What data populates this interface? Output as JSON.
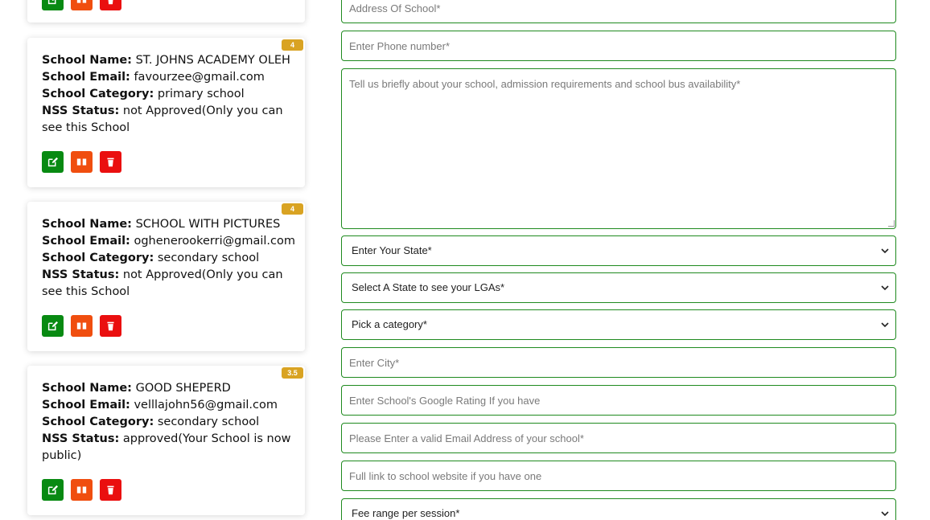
{
  "labels": {
    "name": "School Name:",
    "email": "School Email:",
    "category": "School Category:",
    "status": "NSS Status:"
  },
  "cards": [
    {
      "rating": "4",
      "name": "ST. JOHNS ACADEMY OLEH",
      "email": "favourzee@gmail.com",
      "category": "primary school",
      "status": "not Approved(Only you can see this School"
    },
    {
      "rating": "4",
      "name": "SCHOOL WITH PICTURES",
      "email": "oghenerookerri@gmail.com",
      "category": "secondary school",
      "status": "not Approved(Only you can see this School"
    },
    {
      "rating": "3.5",
      "name": "GOOD SHEPERD",
      "email": "velllajohn56@gmail.com",
      "category": "secondary school",
      "status": "approved(Your School is now public)"
    }
  ],
  "form": {
    "address_placeholder": "Address Of School*",
    "phone_placeholder": "Enter Phone number*",
    "about_placeholder": "Tell us briefly about your school, admission requirements and school bus availability*",
    "state_select": "Enter Your State*",
    "lga_select": "Select A State to see your LGAs*",
    "category_select": "Pick a category*",
    "city_placeholder": "Enter City*",
    "rating_placeholder": "Enter School's Google Rating If you have",
    "email_placeholder": "Please Enter a valid Email Address of your school*",
    "website_placeholder": "Full link to school website if you have one",
    "fee_select": "Fee range per session*"
  },
  "colors": {
    "edit": "#088a12",
    "view": "#f04e0f",
    "delete": "#ea0f0f",
    "badge": "#d9a322",
    "field_border": "#1f8a1f"
  },
  "icons": [
    "edit-icon",
    "book-icon",
    "trash-icon",
    "chevron-down-icon"
  ]
}
